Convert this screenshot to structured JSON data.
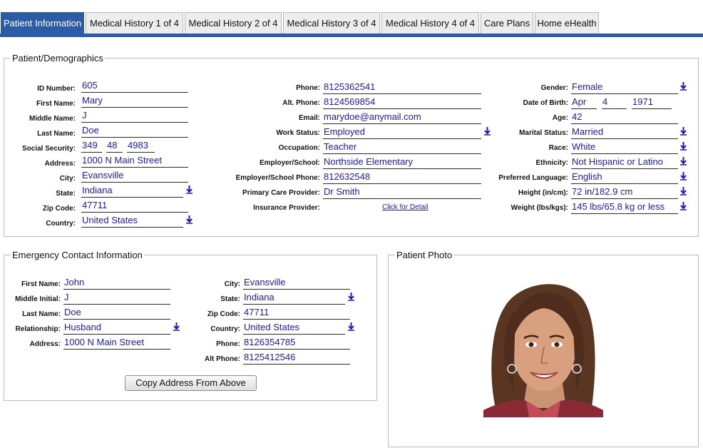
{
  "tabs": [
    {
      "label": "Patient Information",
      "active": true
    },
    {
      "label": "Medical History 1 of 4"
    },
    {
      "label": "Medical History 2 of 4"
    },
    {
      "label": "Medical History 3 of 4"
    },
    {
      "label": "Medical History 4 of 4"
    },
    {
      "label": "Care Plans"
    },
    {
      "label": "Home eHealth"
    }
  ],
  "demographics": {
    "legend": "Patient/Demographics",
    "col1": [
      {
        "label": "ID Number:",
        "value": "605"
      },
      {
        "label": "First Name:",
        "value": "Mary"
      },
      {
        "label": "Middle Name:",
        "value": "J"
      },
      {
        "label": "Last Name:",
        "value": "Doe"
      },
      {
        "label": "Social Security:",
        "parts": [
          "349",
          "48",
          "4983"
        ]
      },
      {
        "label": "Address:",
        "value": "1000 N Main Street"
      },
      {
        "label": "City:",
        "value": "Evansville"
      },
      {
        "label": "State:",
        "value": "Indiana",
        "dropdown": true
      },
      {
        "label": "Zip Code:",
        "value": "47711"
      },
      {
        "label": "Country:",
        "value": "United States",
        "dropdown": true
      }
    ],
    "col2": [
      {
        "label": "Phone:",
        "value": "8125362541"
      },
      {
        "label": "Alt. Phone:",
        "value": "8124569854"
      },
      {
        "label": "Email:",
        "value": "marydoe@anymail.com"
      },
      {
        "label": "Work Status:",
        "value": "Employed",
        "dropdown": true
      },
      {
        "label": "Occupation:",
        "value": "Teacher"
      },
      {
        "label": "Employer/School:",
        "value": "Northside Elementary"
      },
      {
        "label": "Employer/School Phone:",
        "value": "812632548"
      },
      {
        "label": "Primary Care Provider:",
        "value": "Dr Smith"
      },
      {
        "label": "Insurance Provider:",
        "link": "Click for Detail"
      }
    ],
    "col3": [
      {
        "label": "Gender:",
        "value": "Female",
        "dropdown": true
      },
      {
        "label": "Date of Birth:",
        "parts": [
          "Apr",
          "4",
          "1971"
        ]
      },
      {
        "label": "Age:",
        "value": "42"
      },
      {
        "label": "Marital Status:",
        "value": "Married",
        "dropdown": true
      },
      {
        "label": "Race:",
        "value": "White",
        "dropdown": true
      },
      {
        "label": "Ethnicity:",
        "value": "Not Hispanic or Latino",
        "dropdown": true
      },
      {
        "label": "Preferred Language:",
        "value": "English",
        "dropdown": true
      },
      {
        "label": "Height (in/cm):",
        "value": "72 in/182.9 cm",
        "dropdown": true
      },
      {
        "label": "Weight (lbs/kgs):",
        "value": "145 lbs/65.8 kg or less",
        "dropdown": true
      }
    ]
  },
  "emergency": {
    "legend": "Emergency Contact Information",
    "col1": [
      {
        "label": "First Name:",
        "value": "John"
      },
      {
        "label": "Middle Initial:",
        "value": "J"
      },
      {
        "label": "Last Name:",
        "value": "Doe"
      },
      {
        "label": "Relationship:",
        "value": "Husband",
        "dropdown": true
      },
      {
        "label": "Address:",
        "value": "1000 N Main Street"
      }
    ],
    "col2": [
      {
        "label": "City:",
        "value": "Evansville"
      },
      {
        "label": "State:",
        "value": "Indiana",
        "dropdown": true
      },
      {
        "label": "Zip Code:",
        "value": "47711"
      },
      {
        "label": "Country:",
        "value": "United States",
        "dropdown": true
      },
      {
        "label": "Phone:",
        "value": "8126354785"
      },
      {
        "label": "Alt Phone:",
        "value": "8125412546"
      }
    ],
    "button": "Copy Address From Above"
  },
  "photo": {
    "legend": "Patient Photo"
  },
  "colors": {
    "tab_active": "#2d5ca6",
    "field_text": "#1a1ab6"
  }
}
